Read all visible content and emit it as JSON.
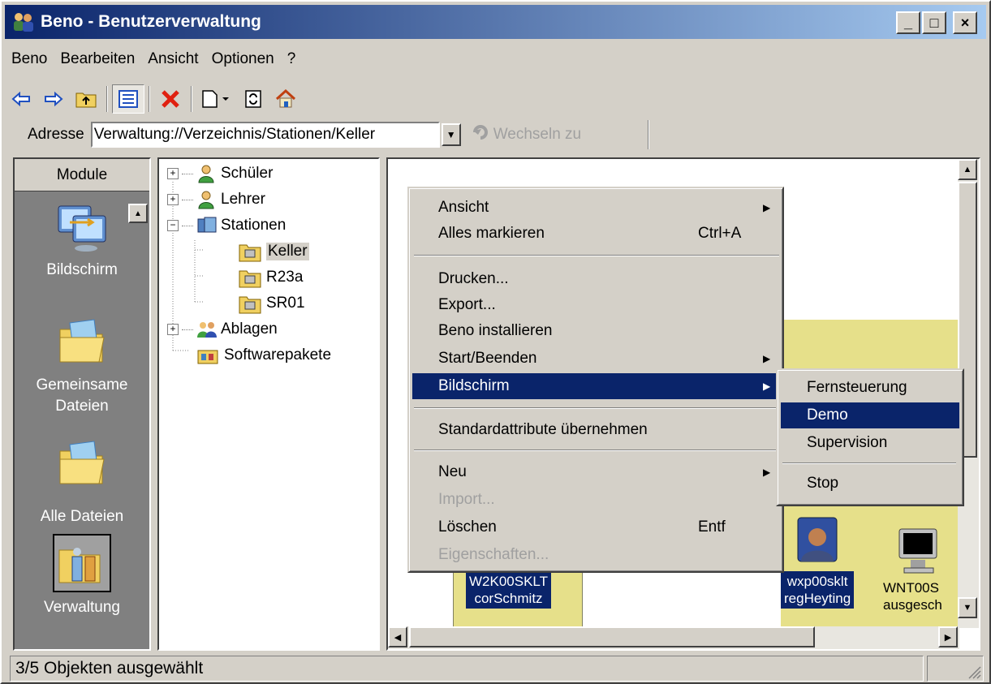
{
  "window": {
    "title": "Beno - Benutzerverwaltung",
    "minimize": "_",
    "maximize": "□",
    "close": "×"
  },
  "menubar": [
    "Beno",
    "Bearbeiten",
    "Ansicht",
    "Optionen",
    "?"
  ],
  "toolbar": {
    "icons": [
      "arrow-left-icon",
      "arrow-right-icon",
      "folder-up-icon",
      "list-view-icon",
      "delete-icon",
      "new-document-icon",
      "refresh-icon",
      "home-icon"
    ]
  },
  "address": {
    "label": "Adresse",
    "value": "Verwaltung://Verzeichnis/Stationen/Keller",
    "go": "Wechseln zu"
  },
  "modules": {
    "header": "Module",
    "items": [
      {
        "label": "Bildschirm",
        "icon": "monitor-icon"
      },
      {
        "label": "Gemeinsame Dateien",
        "icon": "folder-icon"
      },
      {
        "label": "Alle Dateien",
        "icon": "folder-icon"
      },
      {
        "label": "Verwaltung",
        "icon": "admin-icon"
      }
    ]
  },
  "tree": {
    "items": [
      {
        "label": "Schüler",
        "expander": "+"
      },
      {
        "label": "Lehrer",
        "expander": "+"
      },
      {
        "label": "Stationen",
        "expander": "−"
      },
      {
        "label": "Keller"
      },
      {
        "label": "R23a"
      },
      {
        "label": "SR01"
      },
      {
        "label": "Ablagen",
        "expander": "+"
      },
      {
        "label": "Softwarepakete"
      }
    ],
    "selected": "Keller"
  },
  "stations": [
    {
      "line1": "W2K00SKLT",
      "line2": "corSchmitz"
    },
    {
      "line1": "wxp00sklt",
      "line2": "regHeyting"
    },
    {
      "line1": "WNT00S",
      "line2": "ausgesch"
    }
  ],
  "context_menu": {
    "items": [
      {
        "label": "Ansicht",
        "submenu": true
      },
      {
        "label": "Alles markieren",
        "shortcut": "Ctrl+A"
      },
      {
        "label": "Drucken..."
      },
      {
        "label": "Export..."
      },
      {
        "label": "Beno installieren"
      },
      {
        "label": "Start/Beenden",
        "submenu": true
      },
      {
        "label": "Bildschirm",
        "submenu": true,
        "highlighted": true
      },
      {
        "label": "Standardattribute übernehmen"
      },
      {
        "label": "Neu",
        "submenu": true
      },
      {
        "label": "Import...",
        "disabled": true
      },
      {
        "label": "Löschen",
        "shortcut": "Entf"
      },
      {
        "label": "Eigenschaften...",
        "disabled": true
      }
    ]
  },
  "submenu": {
    "items": [
      {
        "label": "Fernsteuerung"
      },
      {
        "label": "Demo",
        "highlighted": true
      },
      {
        "label": "Supervision"
      },
      {
        "label": "Stop"
      }
    ]
  },
  "status": {
    "text": "3/5 Objekten ausgewählt"
  },
  "colors": {
    "titlebar": "#0a246a",
    "selection": "#0a246a",
    "station_bg": "#e6e08a"
  }
}
